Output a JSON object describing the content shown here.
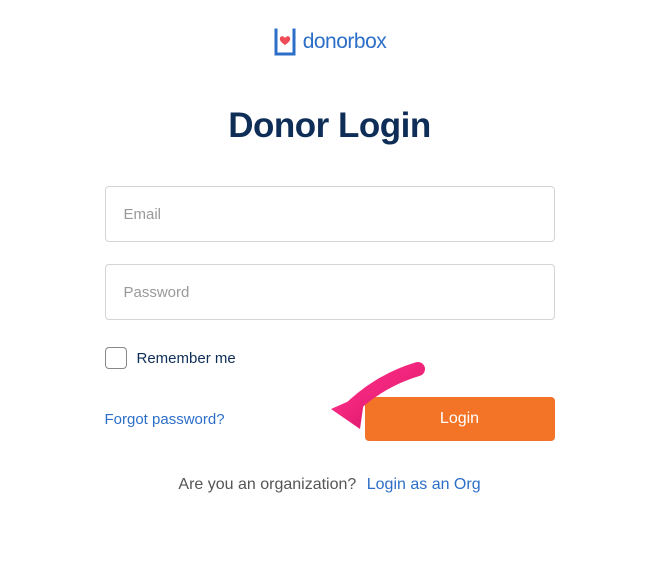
{
  "logo": {
    "text": "donorbox"
  },
  "title": "Donor Login",
  "form": {
    "email_placeholder": "Email",
    "password_placeholder": "Password",
    "remember_label": "Remember me",
    "forgot_label": "Forgot password?",
    "login_label": "Login"
  },
  "footer": {
    "org_prompt": "Are you an organization?",
    "org_link_label": "Login as an Org"
  }
}
